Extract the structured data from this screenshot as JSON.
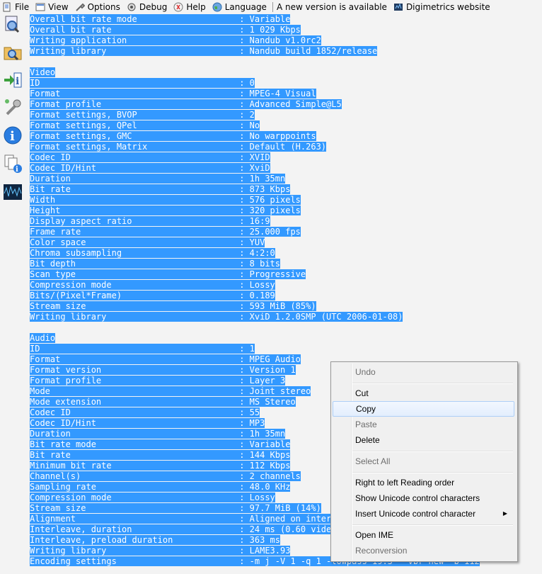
{
  "menubar": {
    "items": [
      {
        "label": "File",
        "icon": "file-icon"
      },
      {
        "label": "View",
        "icon": "view-icon"
      },
      {
        "label": "Options",
        "icon": "options-icon"
      },
      {
        "label": "Debug",
        "icon": "debug-icon"
      },
      {
        "label": "Help",
        "icon": "help-icon"
      },
      {
        "label": "Language",
        "icon": "language-icon"
      }
    ],
    "new_version": "A new version is available",
    "website": "Digimetrics website"
  },
  "toolbar": {
    "buttons": [
      "open-file-icon",
      "open-folder-icon",
      "export-icon",
      "preferences-icon",
      "about-icon",
      "copy-files-icon",
      "waveform-icon"
    ]
  },
  "lines": [
    {
      "text": "Overall bit rate mode                    : Variable"
    },
    {
      "text": "Overall bit rate                         : 1 029 Kbps"
    },
    {
      "text": "Writing application                      : Nandub v1.0rc2"
    },
    {
      "text": "Writing library                          : Nandub build 1852/release"
    },
    {
      "text": ""
    },
    {
      "text": "Video"
    },
    {
      "text": "ID                                       : 0"
    },
    {
      "text": "Format                                   : MPEG-4 Visual"
    },
    {
      "text": "Format profile                           : Advanced Simple@L5"
    },
    {
      "text": "Format settings, BVOP                    : 2"
    },
    {
      "text": "Format settings, QPel                    : No"
    },
    {
      "text": "Format settings, GMC                     : No warppoints"
    },
    {
      "text": "Format settings, Matrix                  : Default (H.263)"
    },
    {
      "text": "Codec ID                                 : XVID"
    },
    {
      "text": "Codec ID/Hint                            : XviD"
    },
    {
      "text": "Duration                                 : 1h 35mn"
    },
    {
      "text": "Bit rate                                 : 873 Kbps"
    },
    {
      "text": "Width                                    : 576 pixels"
    },
    {
      "text": "Height                                   : 320 pixels"
    },
    {
      "text": "Display aspect ratio                     : 16:9"
    },
    {
      "text": "Frame rate                               : 25.000 fps"
    },
    {
      "text": "Color space                              : YUV"
    },
    {
      "text": "Chroma subsampling                       : 4:2:0"
    },
    {
      "text": "Bit depth                                : 8 bits"
    },
    {
      "text": "Scan type                                : Progressive"
    },
    {
      "text": "Compression mode                         : Lossy"
    },
    {
      "text": "Bits/(Pixel*Frame)                       : 0.189"
    },
    {
      "text": "Stream size                              : 593 MiB (85%)"
    },
    {
      "text": "Writing library                          : XviD 1.2.0SMP (UTC 2006-01-08)"
    },
    {
      "text": ""
    },
    {
      "text": "Audio"
    },
    {
      "text": "ID                                       : 1"
    },
    {
      "text": "Format                                   : MPEG Audio"
    },
    {
      "text": "Format version                           : Version 1"
    },
    {
      "text": "Format profile                           : Layer 3"
    },
    {
      "text": "Mode                                     : Joint stereo"
    },
    {
      "text": "Mode extension                           : MS Stereo"
    },
    {
      "text": "Codec ID                                 : 55"
    },
    {
      "text": "Codec ID/Hint                            : MP3"
    },
    {
      "text": "Duration                                 : 1h 35mn"
    },
    {
      "text": "Bit rate mode                            : Variable"
    },
    {
      "text": "Bit rate                                 : 144 Kbps"
    },
    {
      "text": "Minimum bit rate                         : 112 Kbps"
    },
    {
      "text": "Channel(s)                               : 2 channels"
    },
    {
      "text": "Sampling rate                            : 48.0 KHz"
    },
    {
      "text": "Compression mode                         : Lossy"
    },
    {
      "text": "Stream size                              : 97.7 MiB (14%)"
    },
    {
      "text": "Alignment                                : Aligned on interle"
    },
    {
      "text": "Interleave, duration                     : 24 ms (0.60 video"
    },
    {
      "text": "Interleave, preload duration             : 363 ms"
    },
    {
      "text": "Writing library                          : LAME3.93"
    },
    {
      "text": "Encoding settings                        : -m j -V 1 -q 1 -lowpass 19.5 --vbr-new -b 112"
    }
  ],
  "context_menu": {
    "items": [
      {
        "label": "Undo",
        "enabled": false
      },
      {
        "sep": true
      },
      {
        "label": "Cut",
        "enabled": true
      },
      {
        "label": "Copy",
        "enabled": true,
        "highlighted": true
      },
      {
        "label": "Paste",
        "enabled": false
      },
      {
        "label": "Delete",
        "enabled": true
      },
      {
        "sep": true
      },
      {
        "label": "Select All",
        "enabled": false
      },
      {
        "sep": true
      },
      {
        "label": "Right to left Reading order",
        "enabled": true
      },
      {
        "label": "Show Unicode control characters",
        "enabled": true
      },
      {
        "label": "Insert Unicode control character",
        "enabled": true,
        "submenu": true
      },
      {
        "sep": true
      },
      {
        "label": "Open IME",
        "enabled": true
      },
      {
        "label": "Reconversion",
        "enabled": false
      }
    ]
  },
  "colors": {
    "selection": "#3399ff",
    "background": "#f3f3f3"
  }
}
